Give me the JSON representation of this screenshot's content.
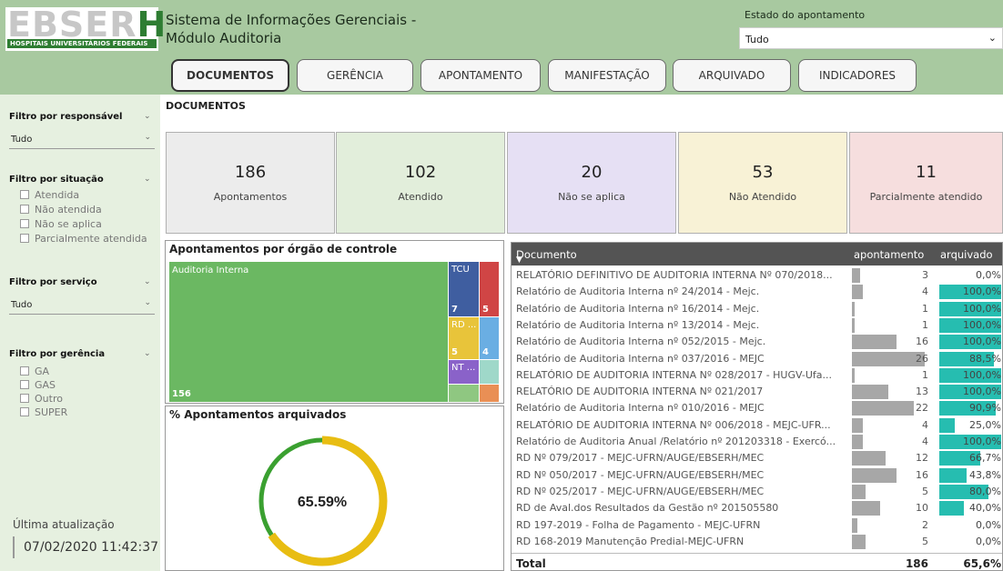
{
  "header": {
    "logo_text": "EBSER",
    "logo_text_h": "H",
    "logo_subtitle": "HOSPITAIS UNIVERSITÁRIOS FEDERAIS",
    "title_line1": "Sistema de Informações Gerenciais -",
    "title_line2": "Módulo Auditoria",
    "estado_label": "Estado do apontamento",
    "estado_value": "Tudo"
  },
  "tabs": [
    {
      "label": "DOCUMENTOS",
      "active": true
    },
    {
      "label": "GERÊNCIA",
      "active": false
    },
    {
      "label": "APONTAMENTO",
      "active": false
    },
    {
      "label": "MANIFESTAÇÃO",
      "active": false
    },
    {
      "label": "ARQUIVADO",
      "active": false
    },
    {
      "label": "INDICADORES",
      "active": false
    }
  ],
  "sidebar": {
    "responsavel_title": "Filtro por responsável",
    "responsavel_value": "Tudo",
    "situacao_title": "Filtro por situação",
    "situacao_options": [
      "Atendida",
      "Não atendida",
      "Não se aplica",
      "Parcialmente atendida"
    ],
    "servico_title": "Filtro por serviço",
    "servico_value": "Tudo",
    "gerencia_title": "Filtro por gerência",
    "gerencia_options": [
      "GA",
      "GAS",
      "Outro",
      "SUPER"
    ],
    "update_label": "Última atualização",
    "update_value": "07/02/2020 11:42:37"
  },
  "section_title": "DOCUMENTOS",
  "cards": [
    {
      "value": "186",
      "label": "Apontamentos",
      "color": "#ececec"
    },
    {
      "value": "102",
      "label": "Atendido",
      "color": "#e2eedb"
    },
    {
      "value": "20",
      "label": "Não se aplica",
      "color": "#e6e0f4"
    },
    {
      "value": "53",
      "label": "Não Atendido",
      "color": "#f8f2d6"
    },
    {
      "value": "11",
      "label": "Parcialmente atendido",
      "color": "#f6dede"
    }
  ],
  "treemap": {
    "title": "Apontamentos por órgão de controle",
    "items": [
      {
        "label": "Auditoria Interna",
        "value": "156",
        "color": "#6bb862"
      },
      {
        "label": "TCU",
        "value": "7",
        "color": "#3f5ea0"
      },
      {
        "label": "",
        "value": "5",
        "color": "#d04545"
      },
      {
        "label": "RD ...",
        "value": "5",
        "color": "#e8c43a"
      },
      {
        "label": "",
        "value": "4",
        "color": "#6aaee3"
      },
      {
        "label": "NT ...",
        "value": "",
        "color": "#8a62c9"
      },
      {
        "label": "",
        "value": "",
        "color": "#9fd8c9"
      },
      {
        "label": "",
        "value": "",
        "color": "#8fc781"
      },
      {
        "label": "",
        "value": "",
        "color": "#e98f55"
      }
    ]
  },
  "gauge": {
    "title": "% Apontamentos arquivados",
    "value_text": "65.59%",
    "fraction": 0.6559,
    "fill_color": "#e8bd12",
    "track_color": "#3aa030"
  },
  "table": {
    "headers": [
      "Documento",
      "apontamento",
      "arquivado"
    ],
    "rows": [
      {
        "doc": "RELATÓRIO DEFINITIVO DE AUDITORIA INTERNA Nº 070/2018...",
        "ap": 3,
        "ar": "0,0%"
      },
      {
        "doc": "Relatório de Auditoria Interna nº 24/2014 - Mejc.",
        "ap": 4,
        "ar": "100,0%"
      },
      {
        "doc": "Relatório de Auditoria Interna nº 16/2014 - Mejc.",
        "ap": 1,
        "ar": "100,0%"
      },
      {
        "doc": "Relatório de Auditoria Interna nº 13/2014 - Mejc.",
        "ap": 1,
        "ar": "100,0%"
      },
      {
        "doc": "Relatório de Auditoria Interna nº 052/2015 - Mejc.",
        "ap": 16,
        "ar": "100,0%"
      },
      {
        "doc": "Relatório de Auditoria Interna nº 037/2016 - MEJC",
        "ap": 26,
        "ar": "88,5%"
      },
      {
        "doc": "RELATÓRIO DE AUDITORIA INTERNA Nº 028/2017 - HUGV-Ufa...",
        "ap": 1,
        "ar": "100,0%"
      },
      {
        "doc": "RELATÓRIO DE AUDITORIA INTERNA Nº 021/2017",
        "ap": 13,
        "ar": "100,0%"
      },
      {
        "doc": "Relatório de Auditoria Interna nº 010/2016 - MEJC",
        "ap": 22,
        "ar": "90,9%"
      },
      {
        "doc": "RELATÓRIO DE AUDITORIA INTERNA Nº 006/2018 - MEJC-UFR...",
        "ap": 4,
        "ar": "25,0%"
      },
      {
        "doc": "Relatório de Auditoria Anual /Relatório nº 201203318 - Exercó...",
        "ap": 4,
        "ar": "100,0%"
      },
      {
        "doc": "RD Nº 079/2017 - MEJC-UFRN/AUGE/EBSERH/MEC",
        "ap": 12,
        "ar": "66,7%"
      },
      {
        "doc": "RD Nº 050/2017 - MEJC-UFRN/AUGE/EBSERH/MEC",
        "ap": 16,
        "ar": "43,8%"
      },
      {
        "doc": "RD Nº 025/2017 - MEJC-UFRN/AUGE/EBSERH/MEC",
        "ap": 5,
        "ar": "80,0%"
      },
      {
        "doc": "RD de Aval.dos Resultados da Gestão nº 201505580",
        "ap": 10,
        "ar": "40,0%"
      },
      {
        "doc": "RD 197-2019 - Folha de Pagamento - MEJC-UFRN",
        "ap": 2,
        "ar": "0,0%"
      },
      {
        "doc": "RD 168-2019 Manutenção Predial-MEJC-UFRN",
        "ap": 5,
        "ar": "0,0%"
      }
    ],
    "total_label": "Total",
    "total_ap": "186",
    "total_ar": "65,6%"
  }
}
